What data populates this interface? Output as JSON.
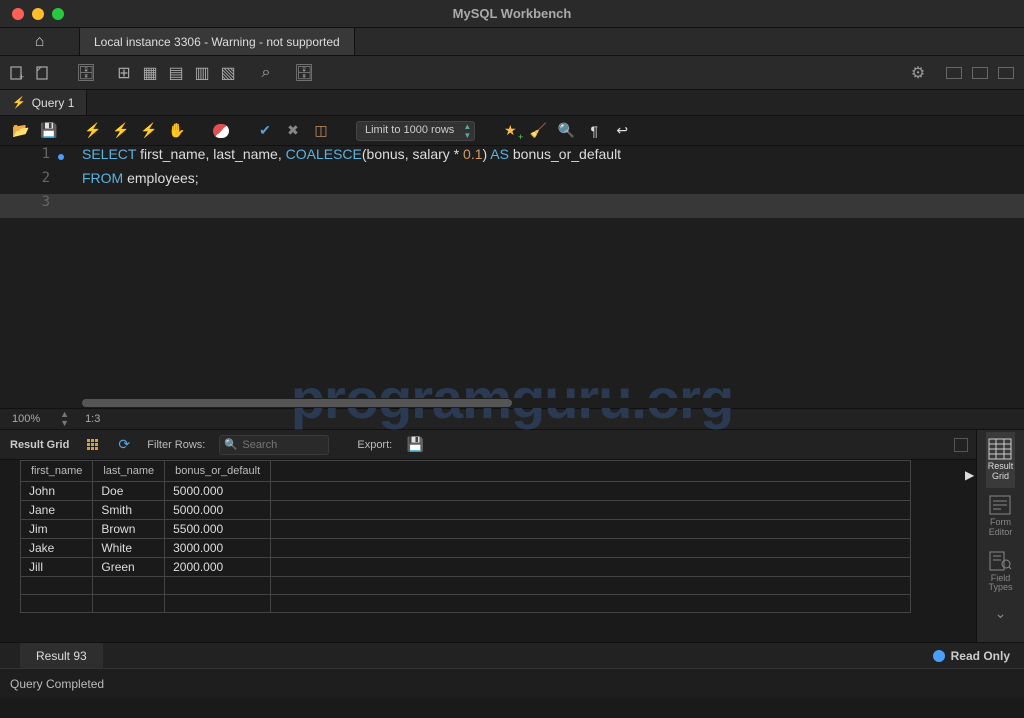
{
  "app_title": "MySQL Workbench",
  "connection_tab": "Local instance 3306 - Warning - not supported",
  "query_tab": "Query 1",
  "editor_toolbar": {
    "limit_label": "Limit to 1000 rows"
  },
  "sql": {
    "lines": [
      {
        "n": "1",
        "html_tokens": [
          "SELECT",
          " first_name",
          ", last_name",
          ", ",
          "COALESCE",
          "(bonus",
          ", salary * ",
          "0.1",
          ") ",
          "AS",
          " bonus_or_default"
        ]
      },
      {
        "n": "2",
        "html_tokens": [
          "FROM",
          " employees;"
        ]
      },
      {
        "n": "3",
        "html_tokens": []
      }
    ]
  },
  "zoom": {
    "percent": "100%",
    "cursor": "1:3"
  },
  "results_toolbar": {
    "label": "Result Grid",
    "filter_label": "Filter Rows:",
    "filter_placeholder": "Search",
    "export_label": "Export:"
  },
  "chart_data": {
    "type": "table",
    "columns": [
      "first_name",
      "last_name",
      "bonus_or_default"
    ],
    "rows": [
      [
        "John",
        "Doe",
        "5000.000"
      ],
      [
        "Jane",
        "Smith",
        "5000.000"
      ],
      [
        "Jim",
        "Brown",
        "5500.000"
      ],
      [
        "Jake",
        "White",
        "3000.000"
      ],
      [
        "Jill",
        "Green",
        "2000.000"
      ]
    ]
  },
  "side_panel": {
    "items": [
      {
        "label": "Result\nGrid",
        "active": true
      },
      {
        "label": "Form\nEditor",
        "active": false
      },
      {
        "label": "Field\nTypes",
        "active": false
      }
    ]
  },
  "result_tab": "Result 93",
  "readonly_label": "Read Only",
  "status": "Query Completed",
  "watermark": "programguru.org"
}
